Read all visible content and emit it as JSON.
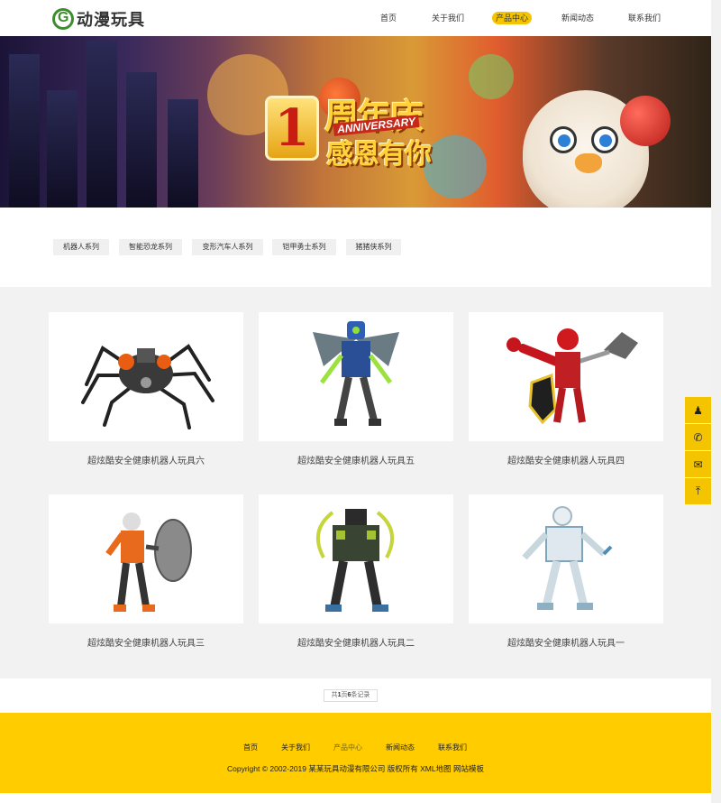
{
  "header": {
    "logo_letter": "G",
    "logo_text": "动漫玩具",
    "nav": [
      {
        "label": "首页",
        "active": false
      },
      {
        "label": "关于我们",
        "active": false
      },
      {
        "label": "产品中心",
        "active": true
      },
      {
        "label": "新闻动态",
        "active": false
      },
      {
        "label": "联系我们",
        "active": false
      }
    ]
  },
  "banner": {
    "number": "1",
    "line_top": "周年庆",
    "line_mid": "ANNIVERSARY",
    "line_bottom": "感恩有你"
  },
  "categories": [
    "机器人系列",
    "智能恐龙系列",
    "变形汽车人系列",
    "铠甲勇士系列",
    "猪猪侠系列"
  ],
  "products": [
    {
      "name": "超炫酷安全健康机器人玩具六",
      "image": "spider-robot-toy"
    },
    {
      "name": "超炫酷安全健康机器人玩具五",
      "image": "winged-robot-toy"
    },
    {
      "name": "超炫酷安全健康机器人玩具四",
      "image": "red-knight-robot-toy"
    },
    {
      "name": "超炫酷安全健康机器人玩具三",
      "image": "shield-robot-toy"
    },
    {
      "name": "超炫酷安全健康机器人玩具二",
      "image": "samurai-robot-toy"
    },
    {
      "name": "超炫酷安全健康机器人玩具一",
      "image": "white-robot-toy"
    }
  ],
  "pagination": {
    "prefix": "共",
    "pages": "1",
    "mid": "页",
    "records": "6",
    "suffix": "条记录"
  },
  "footer": {
    "nav": [
      {
        "label": "首页",
        "active": false
      },
      {
        "label": "关于我们",
        "active": false
      },
      {
        "label": "产品中心",
        "active": true
      },
      {
        "label": "新闻动态",
        "active": false
      },
      {
        "label": "联系我们",
        "active": false
      }
    ],
    "copyright": "Copyright © 2002-2019 某某玩具动漫有限公司 版权所有",
    "xml_map": "XML地图",
    "template": "网站模板"
  },
  "side_tools": [
    {
      "icon": "qq-icon",
      "glyph": "♟"
    },
    {
      "icon": "phone-icon",
      "glyph": "✆"
    },
    {
      "icon": "wechat-icon",
      "glyph": "✉"
    },
    {
      "icon": "back-to-top-icon",
      "glyph": "⤒"
    }
  ],
  "colors": {
    "accent": "#ffcc00",
    "nav_active": "#f4c400",
    "product_bg": "#f2f2f2",
    "category_bg": "#f0f0f0"
  }
}
